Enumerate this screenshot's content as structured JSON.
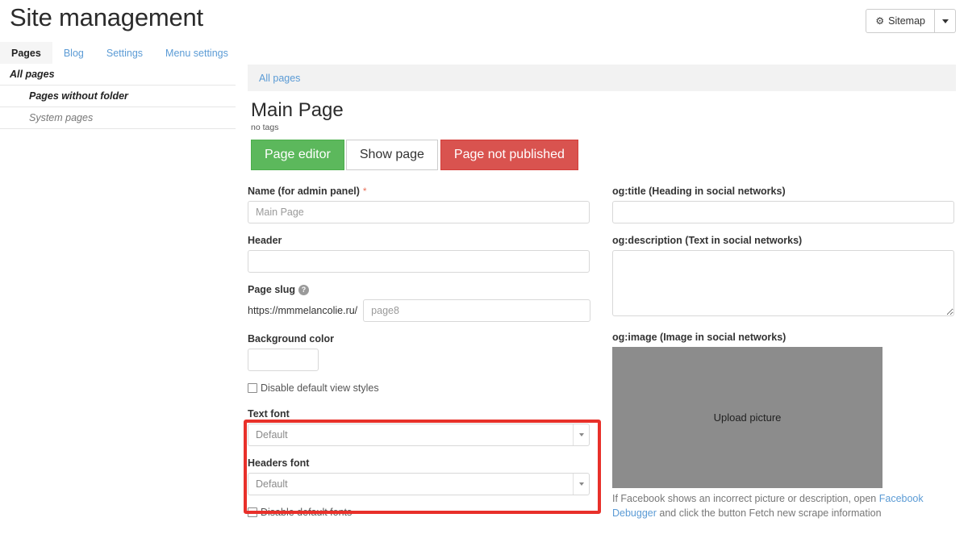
{
  "header": {
    "title": "Site management",
    "sitemap_button": {
      "label": "Sitemap",
      "icon": "gear-icon"
    },
    "dropdown_icon": "chevron-down-icon"
  },
  "tabs": [
    {
      "label": "Pages",
      "active": true
    },
    {
      "label": "Blog",
      "active": false
    },
    {
      "label": "Settings",
      "active": false
    },
    {
      "label": "Menu settings",
      "active": false
    }
  ],
  "sidebar": {
    "items": [
      {
        "label": "All pages",
        "level": 0,
        "muted": false
      },
      {
        "label": "Pages without folder",
        "level": 1,
        "muted": false
      },
      {
        "label": "System pages",
        "level": 1,
        "muted": true
      }
    ]
  },
  "breadcrumb": {
    "items": [
      "All pages"
    ]
  },
  "page": {
    "title": "Main Page",
    "tags": "no tags",
    "actions": [
      {
        "label": "Page editor",
        "style": "green"
      },
      {
        "label": "Show page",
        "style": "white"
      },
      {
        "label": "Page not published",
        "style": "red"
      }
    ]
  },
  "form_left": {
    "name": {
      "label": "Name (for admin panel)",
      "required_marker": "*",
      "value": "",
      "placeholder": "Main Page"
    },
    "header_field": {
      "label": "Header",
      "value": "",
      "placeholder": ""
    },
    "page_slug": {
      "label": "Page slug",
      "help_icon": "question-mark-icon",
      "prefix": "https://mmmelancolie.ru/",
      "value": "",
      "placeholder": "page8"
    },
    "background_color": {
      "label": "Background color",
      "value": ""
    },
    "disable_view_styles": {
      "label": "Disable default view styles",
      "checked": false
    },
    "text_font": {
      "label": "Text font",
      "selected": "Default"
    },
    "headers_font": {
      "label": "Headers font",
      "selected": "Default"
    },
    "disable_default_fonts": {
      "label": "Disable default fonts",
      "checked": false
    }
  },
  "form_right": {
    "og_title": {
      "label": "og:title (Heading in social networks)",
      "value": "",
      "placeholder": ""
    },
    "og_description": {
      "label": "og:description (Text in social networks)",
      "value": "",
      "placeholder": ""
    },
    "og_image": {
      "label": "og:image (Image in social networks)",
      "upload_label": "Upload picture"
    },
    "facebook_note": {
      "part1": "If Facebook shows an incorrect picture or description, open ",
      "link": "Facebook Debugger",
      "part2": " and click the button Fetch new scrape information"
    }
  },
  "colors": {
    "green": "#5cb85c",
    "red": "#d9534f",
    "link": "#5b9bd5",
    "highlight": "#e8302a",
    "breadcrumb_bg": "#f2f2f2",
    "image_placeholder": "#8c8c8c"
  }
}
